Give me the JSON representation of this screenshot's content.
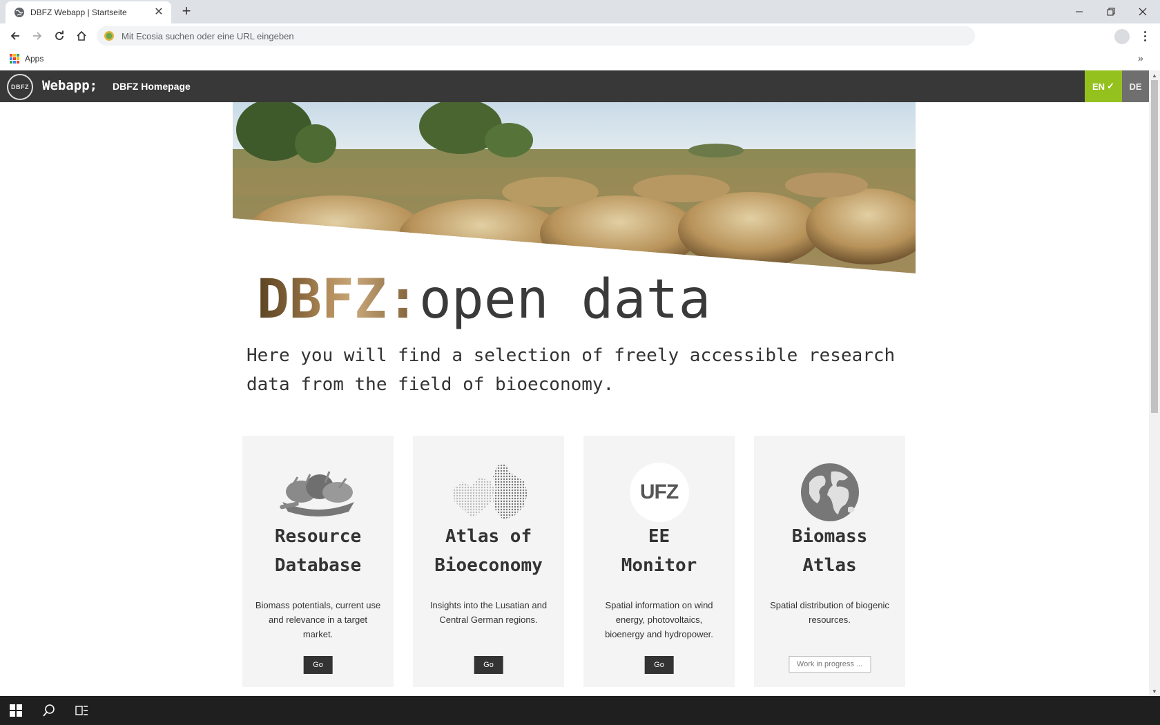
{
  "browser": {
    "tab_title": "DBFZ Webapp | Startseite",
    "address_placeholder": "Mit Ecosia suchen oder eine URL eingeben",
    "bookmarks_apps_label": "Apps"
  },
  "site": {
    "logo_text": "DBFZ",
    "brand": "Webapp;",
    "homepage_link": "DBFZ Homepage",
    "lang_en": "EN",
    "lang_de": "DE",
    "accent_color": "#95c11f"
  },
  "hero": {
    "headline_prefix": "DBFZ:",
    "headline_rest": "open data",
    "intro": "Here you will find a selection of freely accessible research data from the field of bioeconomy."
  },
  "cards": [
    {
      "icon": "harvest-basket-icon",
      "title_line1": "Resource",
      "title_line2": "Database",
      "description": "Biomass potentials, current use and relevance in a target market.",
      "button": "Go"
    },
    {
      "icon": "region-map-icon",
      "title_line1": "Atlas of",
      "title_line2": "Bioeconomy",
      "description": "Insights into the Lusatian and Central German regions.",
      "button": "Go"
    },
    {
      "icon": "ufz-logo-icon",
      "icon_text": "UFZ",
      "title_line1": "EE",
      "title_line2": "Monitor",
      "description": "Spatial information on wind energy, photovoltaics, bioenergy and hydropower.",
      "button": "Go"
    },
    {
      "icon": "globe-icon",
      "title_line1": "Biomass",
      "title_line2": "Atlas",
      "description": "Spatial distribution of biogenic resources.",
      "button": "Work in progress ..."
    }
  ]
}
